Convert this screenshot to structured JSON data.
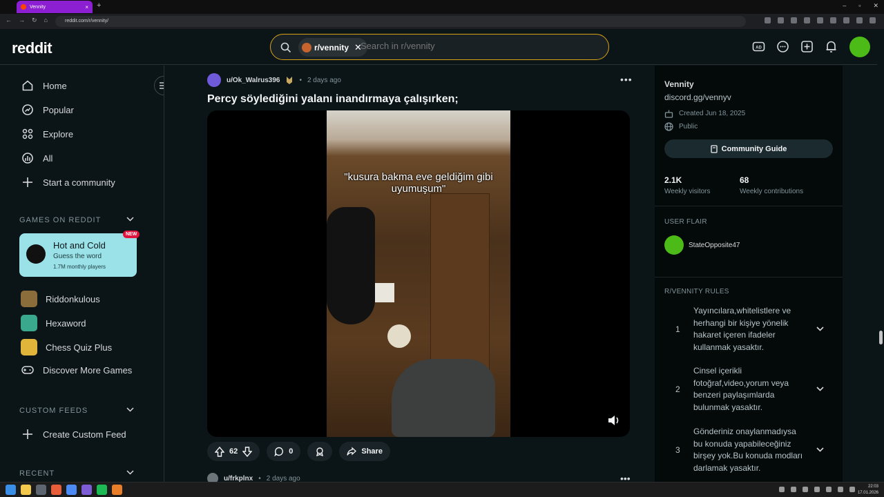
{
  "browser": {
    "tab_title": "Vennity",
    "url": "reddit.com/r/vennity/"
  },
  "header": {
    "logo": "reddit",
    "search_chip": "r/vennity",
    "search_placeholder": "Search in r/vennity"
  },
  "sidebar": {
    "nav": [
      {
        "label": "Home",
        "icon": "home-icon"
      },
      {
        "label": "Popular",
        "icon": "popular-icon"
      },
      {
        "label": "Explore",
        "icon": "explore-icon"
      },
      {
        "label": "All",
        "icon": "all-icon"
      },
      {
        "label": "Start a community",
        "icon": "plus-icon"
      }
    ],
    "games_header": "GAMES ON REDDIT",
    "featured_game": {
      "title": "Hot and Cold",
      "subtitle": "Guess the word",
      "players": "1.7M monthly players",
      "badge": "NEW"
    },
    "games": [
      {
        "label": "Riddonkulous"
      },
      {
        "label": "Hexaword"
      },
      {
        "label": "Chess Quiz Plus"
      },
      {
        "label": "Discover More Games"
      }
    ],
    "custom_feeds_header": "CUSTOM FEEDS",
    "create_custom_feed": "Create Custom Feed",
    "recent_header": "RECENT"
  },
  "post": {
    "author": "u/Ok_Walrus396",
    "time": "2 days ago",
    "separator": "•",
    "title": "Percy söylediğini yalanı inandırmaya çalışırken;",
    "caption": "\"kusura bakma eve geldiğim gibi uyumuşum\"",
    "upvotes": "62",
    "comments": "0",
    "share_label": "Share"
  },
  "next_post": {
    "author": "u/frkplnx",
    "time": "2 days ago"
  },
  "community": {
    "name": "Vennity",
    "description": "discord.gg/vennyv",
    "created": "Created Jun 18, 2025",
    "visibility": "Public",
    "guide_label": "Community Guide",
    "weekly_visitors_value": "2.1K",
    "weekly_visitors_label": "Weekly visitors",
    "weekly_contrib_value": "68",
    "weekly_contrib_label": "Weekly contributions",
    "user_flair_header": "USER FLAIR",
    "flair_user": "StateOpposite47",
    "rules_header": "R/VENNITY RULES",
    "rules": [
      {
        "num": "1",
        "text": "Yayıncılara,whitelistlere ve herhangi bir kişiye yönelik hakaret içeren ifadeler kullanmak yasaktır."
      },
      {
        "num": "2",
        "text": "Cinsel içerikli fotoğraf,video,yorum veya benzeri paylaşımlarda bulunmak yasaktır."
      },
      {
        "num": "3",
        "text": "Gönderiniz onaylanmadıysa bu konuda yapabileceğiniz birşey yok.Bu konuda modları darlamak yasaktır."
      }
    ]
  },
  "taskbar": {
    "time": "22:03",
    "date": "17.01.2026"
  },
  "colors": {
    "background": "#0b1416",
    "search_border": "#d9a319",
    "accent_tab": "#8b1fd1",
    "game_card": "#9ae2e8",
    "new_badge": "#e0133e"
  }
}
